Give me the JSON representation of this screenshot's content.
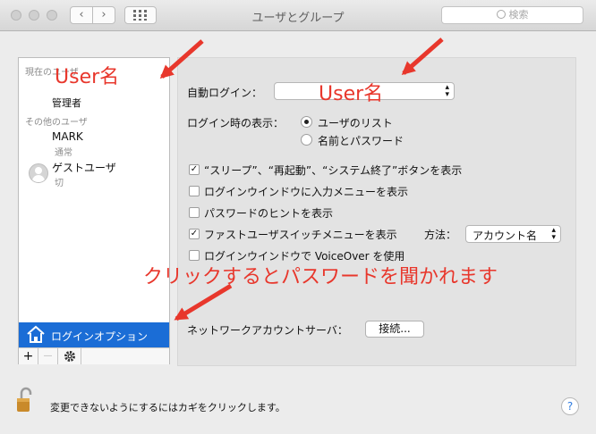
{
  "window": {
    "title": "ユーザとグループ",
    "search_placeholder": "検索",
    "nav_back": "‹",
    "nav_forward": "›"
  },
  "sidebar": {
    "current_user_header": "現在のユーザ",
    "current_user_role": "管理者",
    "other_users_header": "その他のユーザ",
    "other_user_name": "MARK",
    "other_user_role": "通常",
    "guest_name": "ゲストユーザ",
    "guest_status": "切",
    "login_options_label": "ログインオプション",
    "add_label": "+",
    "remove_label": "—"
  },
  "main": {
    "auto_login_label": "自動ログイン：",
    "auto_login_value": "",
    "display_label": "ログイン時の表示：",
    "radio_list": "ユーザのリスト",
    "radio_name_password": "名前とパスワード",
    "checkboxes": [
      {
        "label": "“スリープ”、“再起動”、“システム終了”ボタンを表示",
        "checked": true
      },
      {
        "label": "ログインウインドウに入力メニューを表示",
        "checked": false
      },
      {
        "label": "パスワードのヒントを表示",
        "checked": false
      },
      {
        "label": "ファストユーザスイッチメニューを表示",
        "checked": true
      },
      {
        "label": "ログインウインドウで VoiceOver を使用",
        "checked": false
      }
    ],
    "method_label": "方法：",
    "method_value": "アカウント名",
    "network_label": "ネットワークアカウントサーバ：",
    "join_button": "接続..."
  },
  "footer": {
    "lock_text": "変更できないようにするにはカギをクリックします。",
    "help_label": "?"
  },
  "annotations": {
    "username_left": "User名",
    "username_right": "User名",
    "click_note": "クリックするとパスワードを聞かれます",
    "color": "#e8372c"
  }
}
